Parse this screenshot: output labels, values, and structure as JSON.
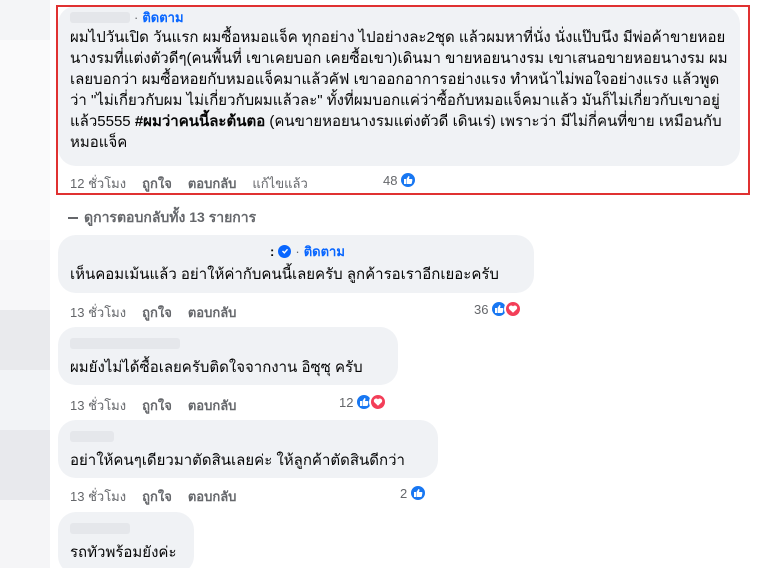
{
  "main_comment": {
    "follow_label": "ติดตาม",
    "text_before_tag": "ผมไปวันเปิด วันแรก ผมซื้อหมอแจ็ค ทุกอย่าง ไปอย่างละ2ชุด แล้วผมหาที่นั่ง นั่งแป๊บนึง มีพ่อค้าขายหอยนางรมที่แต่งตัวดีๆ(คนพื้นที่ เขาเคยบอก เคยซื้อเขา)เดินมา ขายหอยนางรม เขาเสนอขายหอยนางรม ผมเลยบอกว่า ผมซื้อหอยกับหมอแจ็คมาแล้วคัฟ เขาออกอาการอย่างแรง ทำหน้าไม่พอใจอย่างแรง แล้วพูดว่า \"ไม่เกี่ยวกับผม ไม่เกี่ยวกับผมแล้วละ\" ทั้งที่ผมบอกแค่ว่าซื้อกับหมอแจ็คมาแล้ว มันก็ไม่เกี่ยวกับเขาอยู่แล้ว5555 ",
    "hashtag": "#ผมว่าคนนี้ละต้นตอ",
    "text_after_tag": " (คนขายหอยนางรมแต่งตัวดี เดินเร่) เพราะว่า มีไม่กี่คนที่ขาย เหมือนกับหมอแจ็ค",
    "time": "12 ชั่วโมง",
    "like_label": "ถูกใจ",
    "reply_label": "ตอบกลับ",
    "edited_label": "แก้ไขแล้ว",
    "reaction_count": "48"
  },
  "view_replies_label": "ดูการตอบกลับทั้ง 13 รายการ",
  "replies": [
    {
      "separator": ":",
      "follow_label": "ติดตาม",
      "text": "เห็นคอมเม้นแล้ว อย่าให้ค่ากับคนนี้เลยครับ ลูกค้ารอเราอีกเยอะครับ",
      "time": "13 ชั่วโมง",
      "like_label": "ถูกใจ",
      "reply_label": "ตอบกลับ",
      "reaction_count": "36"
    },
    {
      "text": "ผมยังไม่ได้ซื้อเลยครับติดใจจากงาน อิซุซุ ครับ",
      "time": "13 ชั่วโมง",
      "like_label": "ถูกใจ",
      "reply_label": "ตอบกลับ",
      "reaction_count": "12"
    },
    {
      "text": "อย่าให้คนๆเดียวมาตัดสินเลยค่ะ ให้ลูกค้าตัดสินดีกว่า",
      "time": "13 ชั่วโมง",
      "like_label": "ถูกใจ",
      "reply_label": "ตอบกลับ",
      "reaction_count": "2"
    },
    {
      "text": "รถทัวพร้อมยังค่ะ"
    }
  ],
  "colors": {
    "bubble": "#f0f2f5",
    "follow": "#0866ff",
    "like": "#1877f2",
    "love": "#f33e58",
    "highlight_box": "#e03131",
    "meta_text": "#65676b"
  },
  "icons": [
    "like-icon",
    "love-icon",
    "verified-badge-icon"
  ]
}
